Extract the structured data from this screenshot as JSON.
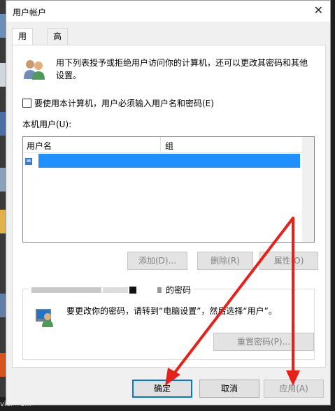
{
  "dialog": {
    "title": "用户帐户",
    "close_glyph": "✕"
  },
  "tabs": [
    {
      "label": "用户",
      "active": true
    },
    {
      "label": "高级",
      "active": false
    }
  ],
  "intro_text": "用下列表授予或拒绝用户访问你的计算机，还可以更改其密码和其他设置。",
  "require_login": {
    "checked": false,
    "label": "要使用本计算机，用户必须输入用户名和密码(E)"
  },
  "user_list": {
    "label": "本机用户(U):",
    "columns": [
      "用户名",
      "组"
    ],
    "rows": [
      {
        "name": "",
        "group": "",
        "redacted": true
      }
    ]
  },
  "list_buttons": {
    "add": "添加(D)...",
    "remove": "删除(R)",
    "properties": "属性(O)"
  },
  "password_group": {
    "title": "的密码",
    "text": "要更改你的密码，请转到“电脑设置”，然后选择“用户”。",
    "reset_button": "重置密码(P)..."
  },
  "footer_buttons": {
    "ok": "确定",
    "cancel": "取消",
    "apply": "应用(A)"
  },
  "colors": {
    "accent": "#0078d7",
    "redaction": "#1e90ff",
    "annotation_arrow": "#e8201a"
  },
  "desktop": {
    "taskbar_text": "vier - 1..."
  }
}
